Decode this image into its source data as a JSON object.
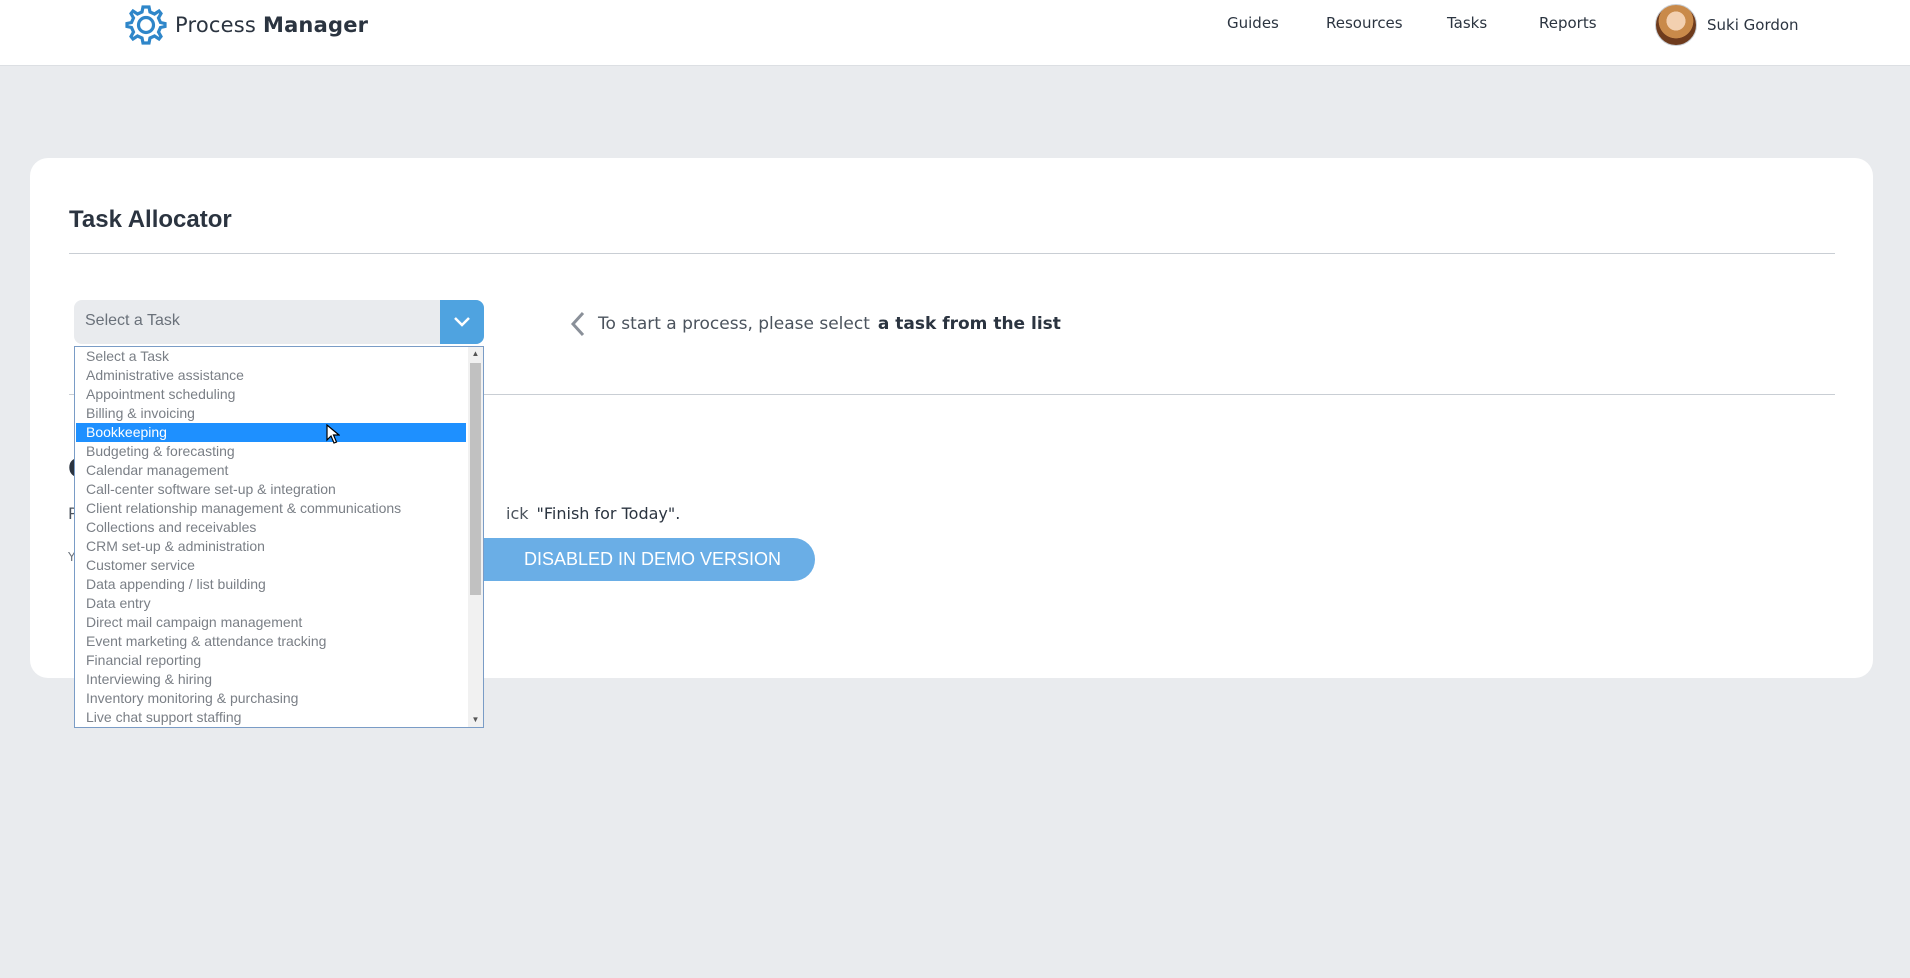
{
  "header": {
    "app_name_light": "Process",
    "app_name_bold": "Manager",
    "nav": [
      "Guides",
      "Resources",
      "Tasks",
      "Reports"
    ],
    "user_name": "Suki Gordon"
  },
  "allocator": {
    "title": "Task Allocator",
    "select_value": "Select a Task",
    "hint_text": "To start a process, please select",
    "hint_bold": "a task from the list",
    "instruction_tail": "ick",
    "instruction_quote": "\"Finish for Today\".",
    "demo_button": "DISABLED IN DEMO VERSION",
    "hidden_heading_letter": "C",
    "instruction_head_letter": "P",
    "small_letter": "Y"
  },
  "dropdown": {
    "options": [
      "Select a Task",
      "Administrative assistance",
      "Appointment scheduling",
      "Billing & invoicing",
      "Bookkeeping",
      "Budgeting & forecasting",
      "Calendar management",
      "Call-center software set-up & integration",
      "Client relationship management & communications",
      "Collections and receivables",
      "CRM set-up & administration",
      "Customer service",
      "Data appending / list building",
      "Data entry",
      "Direct mail campaign management",
      "Event marketing & attendance tracking",
      "Financial reporting",
      "Interviewing & hiring",
      "Inventory monitoring & purchasing",
      "Live chat support staffing"
    ],
    "selected": "Bookkeeping"
  },
  "colors": {
    "accent": "#4fa3e0",
    "selected_option": "#1e90ff",
    "page_bg": "#e9ebee",
    "demo_button": "#6aaee6"
  }
}
